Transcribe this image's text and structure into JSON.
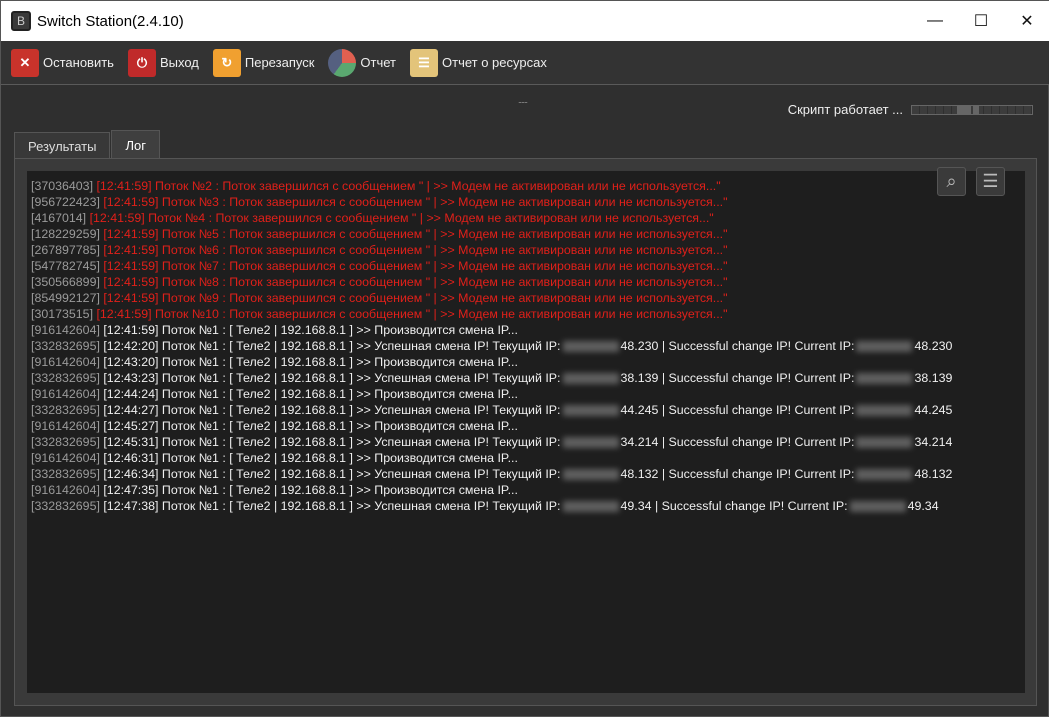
{
  "window": {
    "title": "Switch Station(2.4.10)",
    "app_icon": "B",
    "minimize": "—",
    "maximize": "☐",
    "close": "✕"
  },
  "toolbar": [
    {
      "label": "Остановить",
      "icon": "stop-icon",
      "color": "#c8332b",
      "glyph": "✕"
    },
    {
      "label": "Выход",
      "icon": "power-icon",
      "color": "#c02a2a",
      "glyph": "⏻"
    },
    {
      "label": "Перезапуск",
      "icon": "restart-icon",
      "color": "#f0a030",
      "glyph": "↻"
    },
    {
      "label": "Отчет",
      "icon": "pie-chart-icon",
      "color": "pie",
      "glyph": ""
    },
    {
      "label": "Отчет о ресурсах",
      "icon": "list-icon",
      "color": "#e3c47a",
      "glyph": "☰"
    }
  ],
  "grip": "......",
  "status": {
    "text": "Скрипт работает ...",
    "progress_indeterminate": true
  },
  "tabs": [
    {
      "label": "Результаты",
      "active": false
    },
    {
      "label": "Лог",
      "active": true
    }
  ],
  "log_tools": {
    "search": "⌕",
    "menu": "☰"
  },
  "log": [
    {
      "id": "[37036403]",
      "time": "[12:41:59]",
      "text": " Поток №2 : Поток завершился с сообщением \" | >> Модем не активирован или не используется...\"",
      "type": "err"
    },
    {
      "id": "[956722423]",
      "time": "[12:41:59]",
      "text": " Поток №3 : Поток завершился с сообщением \" | >> Модем не активирован или не используется...\"",
      "type": "err"
    },
    {
      "id": "[4167014]",
      "time": "[12:41:59]",
      "text": " Поток №4 : Поток завершился с сообщением \" | >> Модем не активирован или не используется...\"",
      "type": "err"
    },
    {
      "id": "[128229259]",
      "time": "[12:41:59]",
      "text": " Поток №5 : Поток завершился с сообщением \" | >> Модем не активирован или не используется...\"",
      "type": "err"
    },
    {
      "id": "[267897785]",
      "time": "[12:41:59]",
      "text": " Поток №6 : Поток завершился с сообщением \" | >> Модем не активирован или не используется...\"",
      "type": "err"
    },
    {
      "id": "[547782745]",
      "time": "[12:41:59]",
      "text": " Поток №7 : Поток завершился с сообщением \" | >> Модем не активирован или не используется...\"",
      "type": "err"
    },
    {
      "id": "[350566899]",
      "time": "[12:41:59]",
      "text": " Поток №8 : Поток завершился с сообщением \" | >> Модем не активирован или не используется...\"",
      "type": "err"
    },
    {
      "id": "[854992127]",
      "time": "[12:41:59]",
      "text": " Поток №9 : Поток завершился с сообщением \" | >> Модем не активирован или не используется...\"",
      "type": "err"
    },
    {
      "id": "[30173515]",
      "time": "[12:41:59]",
      "text": " Поток №10 : Поток завершился с сообщением \" | >> Модем не активирован или не используется...\"",
      "type": "err"
    },
    {
      "id": "[916142604]",
      "time": "[12:41:59]",
      "text": " Поток №1 : [ Теле2 | 192.168.8.1 ] >> Производится смена IP...",
      "type": "info"
    },
    {
      "id": "[332832695]",
      "time": "[12:42:20]",
      "text": " Поток №1 : [ Теле2 | 192.168.8.1 ] >> Успешная смена IP! Текущий IP:",
      "type": "ok",
      "ip": "48.230",
      "text2": " | Successful change IP! Current IP:"
    },
    {
      "id": "[916142604]",
      "time": "[12:43:20]",
      "text": " Поток №1 : [ Теле2 | 192.168.8.1 ] >> Производится смена IP...",
      "type": "info"
    },
    {
      "id": "[332832695]",
      "time": "[12:43:23]",
      "text": " Поток №1 : [ Теле2 | 192.168.8.1 ] >> Успешная смена IP! Текущий IP:",
      "type": "ok",
      "ip": "38.139",
      "text2": " | Successful change IP! Current IP:"
    },
    {
      "id": "[916142604]",
      "time": "[12:44:24]",
      "text": " Поток №1 : [ Теле2 | 192.168.8.1 ] >> Производится смена IP...",
      "type": "info"
    },
    {
      "id": "[332832695]",
      "time": "[12:44:27]",
      "text": " Поток №1 : [ Теле2 | 192.168.8.1 ] >> Успешная смена IP! Текущий IP:",
      "type": "ok",
      "ip": "44.245",
      "text2": " | Successful change IP! Current IP:"
    },
    {
      "id": "[916142604]",
      "time": "[12:45:27]",
      "text": " Поток №1 : [ Теле2 | 192.168.8.1 ] >> Производится смена IP...",
      "type": "info"
    },
    {
      "id": "[332832695]",
      "time": "[12:45:31]",
      "text": " Поток №1 : [ Теле2 | 192.168.8.1 ] >> Успешная смена IP! Текущий IP:",
      "type": "ok",
      "ip": "34.214",
      "text2": " | Successful change IP! Current IP:"
    },
    {
      "id": "[916142604]",
      "time": "[12:46:31]",
      "text": " Поток №1 : [ Теле2 | 192.168.8.1 ] >> Производится смена IP...",
      "type": "info"
    },
    {
      "id": "[332832695]",
      "time": "[12:46:34]",
      "text": " Поток №1 : [ Теле2 | 192.168.8.1 ] >> Успешная смена IP! Текущий IP:",
      "type": "ok",
      "ip": "48.132",
      "text2": " | Successful change IP! Current IP:"
    },
    {
      "id": "[916142604]",
      "time": "[12:47:35]",
      "text": " Поток №1 : [ Теле2 | 192.168.8.1 ] >> Производится смена IP...",
      "type": "info"
    },
    {
      "id": "[332832695]",
      "time": "[12:47:38]",
      "text": " Поток №1 : [ Теле2 | 192.168.8.1 ] >> Успешная смена IP! Текущий IP:",
      "type": "ok",
      "ip": "49.34",
      "text2": " | Successful change IP! Current IP:"
    }
  ]
}
